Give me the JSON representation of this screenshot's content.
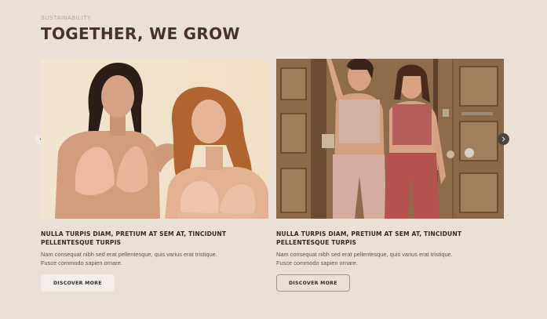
{
  "section": {
    "eyebrow": "SUSTAINABILITY",
    "heading": "TOGETHER, WE GROW"
  },
  "carousel": {
    "prev_icon": "chevron-left-icon",
    "next_icon": "chevron-right-icon",
    "cards": [
      {
        "image_alt": "Two models wearing lace lingerie",
        "title": "NULLA TURPIS DIAM, PRETIUM AT SEM AT, TINCIDUNT PELLENTESQUE TURPIS",
        "desc_line1": "Nam consequat nibh sed erat pellentesque, quis varius erat tristique.",
        "desc_line2": "Fusce commodo sapien ornare.",
        "button": "DISCOVER MORE"
      },
      {
        "image_alt": "Two models in activewear against a wooden door",
        "title": "NULLA TURPIS DIAM, PRETIUM AT SEM AT, TINCIDUNT PELLENTESQUE TURPIS",
        "desc_line1": "Nam consequat nibh sed erat pellentesque, quis varius erat tristique.",
        "desc_line2": "Fusce commodo sapien ornare.",
        "button": "DISCOVER MORE"
      }
    ]
  },
  "colors": {
    "background": "#ebe0d6",
    "heading": "#4b3227",
    "eyebrow": "#b8a290",
    "next_arrow": "#4d4540"
  }
}
